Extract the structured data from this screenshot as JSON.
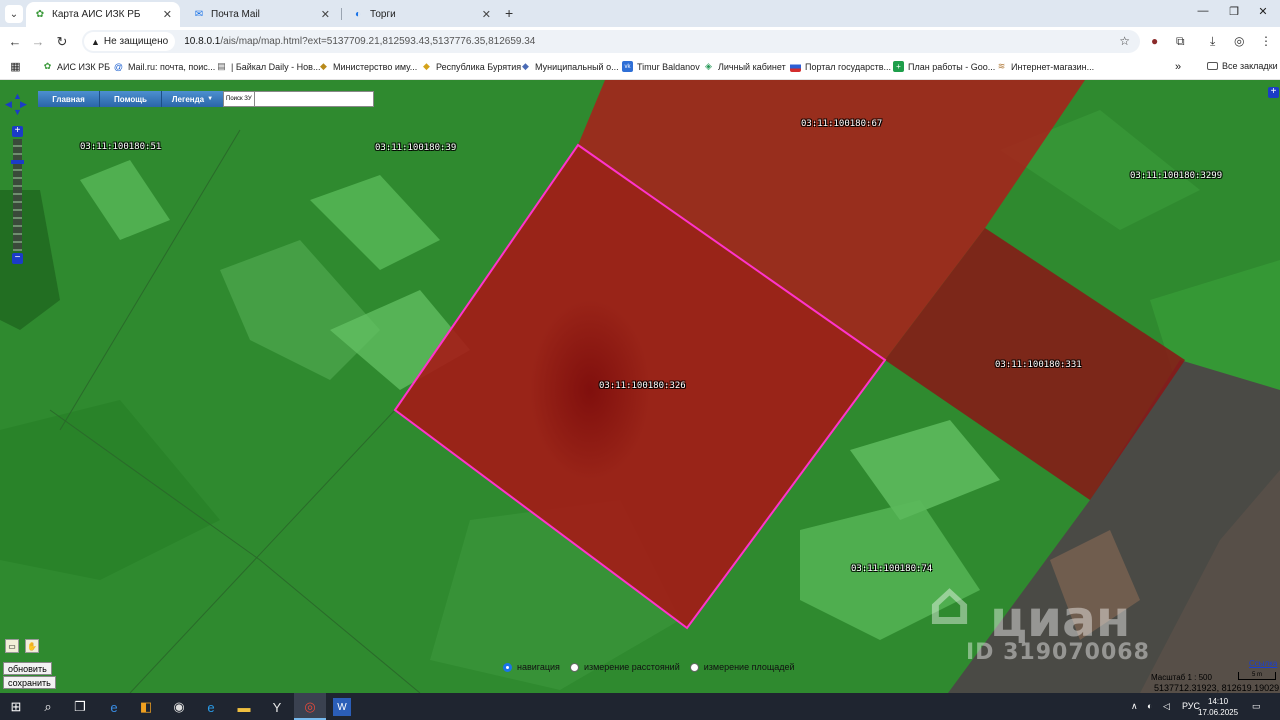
{
  "browser": {
    "tabs": [
      {
        "title": "Карта АИС ИЗК РБ",
        "icon": "leaf-icon",
        "active": true
      },
      {
        "title": "Почта Mail",
        "icon": "mail-icon",
        "active": false
      },
      {
        "title": "Торги",
        "icon": "globe-icon",
        "active": false
      }
    ],
    "security_label": "Не защищено",
    "url_host": "10.8.0.1",
    "url_path": "/ais/map/map.html?ext=5137709.21,812593.43,5137776.35,812659.34",
    "bookmarks": [
      {
        "label": "АИС ИЗК РБ",
        "icon": "leaf-icon"
      },
      {
        "label": "Mail.ru: почта, поис...",
        "icon": "at-icon"
      },
      {
        "label": "| Байкал Daily - Нов...",
        "icon": "news-icon"
      },
      {
        "label": "Министерство иму...",
        "icon": "crest-icon"
      },
      {
        "label": "Республика Бурятия",
        "icon": "crest-icon"
      },
      {
        "label": "Муниципальный о...",
        "icon": "crest-icon"
      },
      {
        "label": "Timur Baldanov",
        "icon": "vk-icon"
      },
      {
        "label": "Личный кабинет",
        "icon": "tax-icon"
      },
      {
        "label": "Портал государств...",
        "icon": "flag-icon"
      },
      {
        "label": "План работы - Goo...",
        "icon": "sheets-icon"
      },
      {
        "label": "Интернет-магазин...",
        "icon": "shop-icon"
      }
    ],
    "all_bookmarks_label": "Все закладки"
  },
  "map": {
    "menu": [
      {
        "label": "Главная"
      },
      {
        "label": "Помощь"
      },
      {
        "label": "Легенда"
      }
    ],
    "search_label": "Поиск ЗУ",
    "search_value": "",
    "parcel_labels": [
      "03:11:100180:51",
      "03:11:100180:39",
      "03:11:100180:67",
      "03:11:100180:3299",
      "03:11:100180:326",
      "03:11:100180:331",
      "03:11:100180:74"
    ],
    "refresh_label": "обновить",
    "save_label": "сохранить",
    "modes": [
      {
        "label": "навигация",
        "selected": true
      },
      {
        "label": "измерение расстояний",
        "selected": false
      },
      {
        "label": "измерение площадей",
        "selected": false
      }
    ],
    "scale_link": "Ссылка",
    "scale_bar_label": "5 m",
    "scale_text": "Масштаб 1 : 500",
    "coords": "5137712.31923, 812619.19029",
    "watermark_brand": "циан",
    "watermark_id": "ID 319070068",
    "colors": {
      "selected_outline": "#ff33cc",
      "parcel_fill": "#b01515",
      "ground": "#2f8a2f"
    }
  },
  "taskbar": {
    "lang": "РУС",
    "time": "14:10",
    "date": "17.06.2025"
  }
}
